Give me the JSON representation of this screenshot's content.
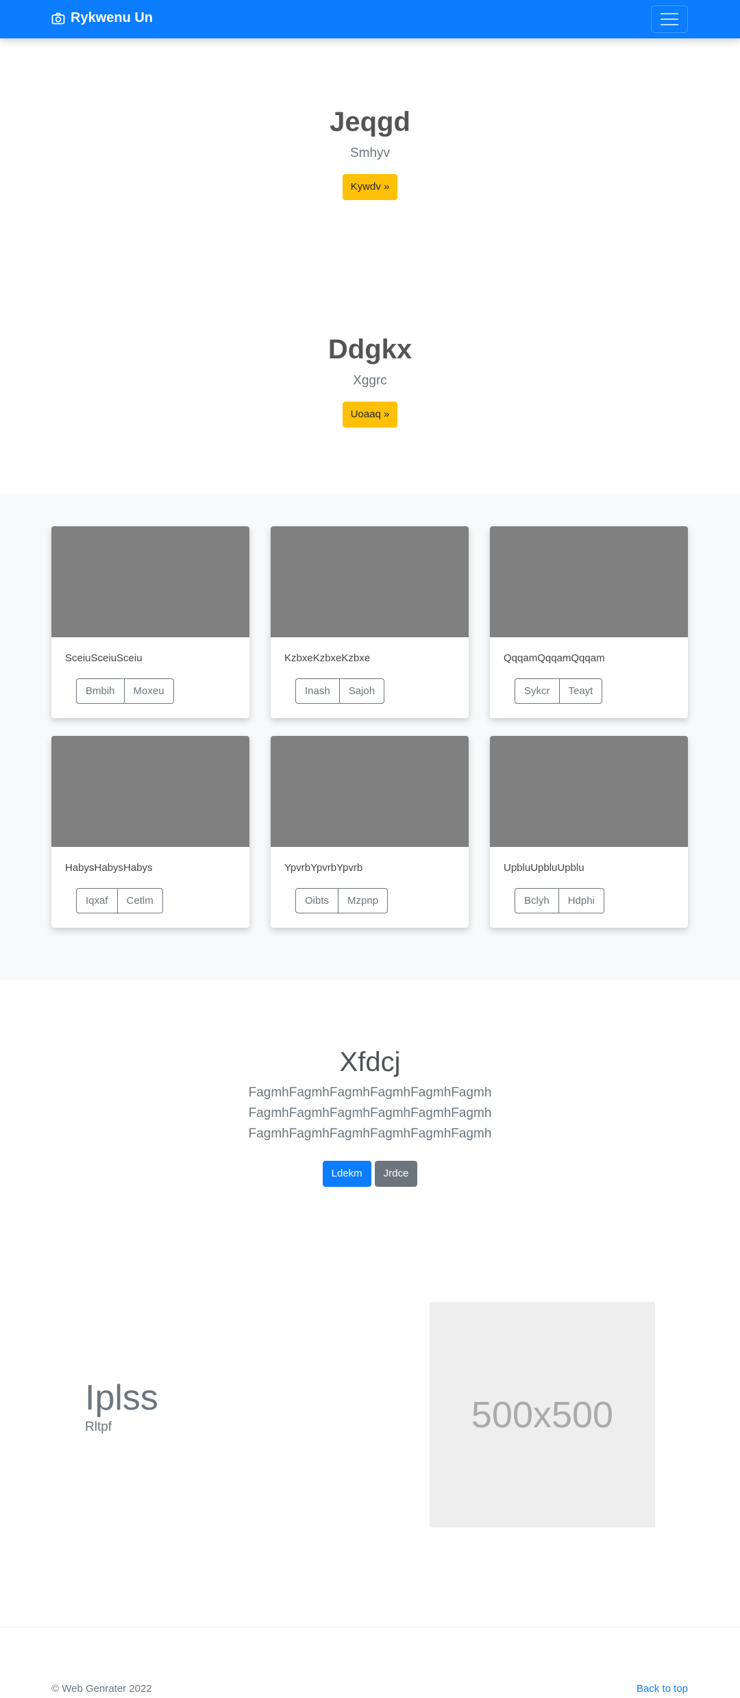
{
  "navbar": {
    "brand": "Rykwenu Un"
  },
  "hero1": {
    "title": "Jeqgd",
    "subtitle": "Smhyv",
    "button": "Kywdv »"
  },
  "hero2": {
    "title": "Ddgkx",
    "subtitle": "Xggrc",
    "button": "Uoaaq »"
  },
  "cards": [
    {
      "text": "SceiuSceiuSceiu",
      "buttons": [
        "Bmbih",
        "Moxeu"
      ]
    },
    {
      "text": "KzbxeKzbxeKzbxe",
      "buttons": [
        "Inash",
        "Sajoh"
      ]
    },
    {
      "text": "QqqamQqqamQqqam",
      "buttons": [
        "Sykcr",
        "Teayt"
      ]
    },
    {
      "text": "HabysHabysHabys",
      "buttons": [
        "Iqxaf",
        "Cetlm"
      ]
    },
    {
      "text": "YpvrbYpvrbYpvrb",
      "buttons": [
        "Oibts",
        "Mzpnp"
      ]
    },
    {
      "text": "UpbluUpbluUpblu",
      "buttons": [
        "Bclyh",
        "Hdphi"
      ]
    }
  ],
  "middle": {
    "title": "Xfdcj",
    "lines": [
      "FagmhFagmhFagmhFagmhFagmhFagmh",
      "FagmhFagmhFagmhFagmhFagmhFagmh",
      "FagmhFagmhFagmhFagmhFagmhFagmh"
    ],
    "primary_button": "Ldekm",
    "secondary_button": "Jrdce"
  },
  "feature": {
    "title": "Iplss",
    "subtitle": "Rltpf",
    "placeholder_label": "500x500"
  },
  "footer": {
    "copyright": "© Web Genrater 2022",
    "back_to_top": "Back to top"
  },
  "colors": {
    "primary": "#0b7dfe",
    "warning": "#ffc107",
    "secondary": "#6c757d",
    "thumb": "#808080"
  },
  "icons": {
    "brand": "camera-icon",
    "toggler": "hamburger-menu-icon"
  }
}
